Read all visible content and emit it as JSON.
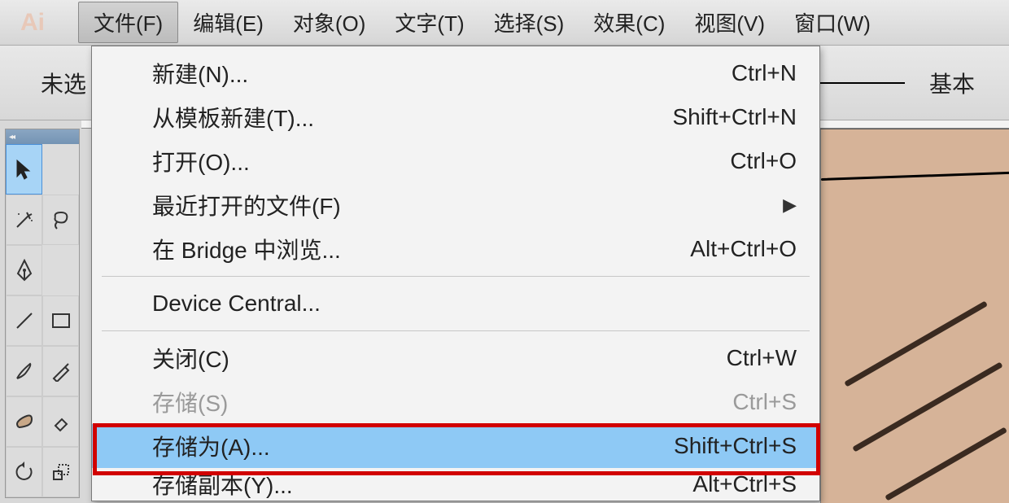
{
  "app": {
    "logo_text": "Ai"
  },
  "menubar": {
    "items": [
      {
        "label": "文件(F)",
        "active": true
      },
      {
        "label": "编辑(E)"
      },
      {
        "label": "对象(O)"
      },
      {
        "label": "文字(T)"
      },
      {
        "label": "选择(S)"
      },
      {
        "label": "效果(C)"
      },
      {
        "label": "视图(V)"
      },
      {
        "label": "窗口(W)"
      }
    ]
  },
  "options_bar": {
    "selection_label": "未选",
    "stroke_style_label": "基本"
  },
  "toolbox": {
    "rows": [
      [
        "selection-tool",
        "direct-selection-tool"
      ],
      [
        "magic-wand-tool",
        "lasso-tool"
      ],
      [
        "pen-tool",
        "type-tool"
      ],
      [
        "line-tool",
        "rectangle-tool"
      ],
      [
        "paintbrush-tool",
        "pencil-tool"
      ],
      [
        "blob-brush-tool",
        "eraser-tool"
      ],
      [
        "rotate-tool",
        "scale-tool"
      ]
    ]
  },
  "dropdown": {
    "items": [
      {
        "label": "新建(N)...",
        "shortcut": "Ctrl+N"
      },
      {
        "label": "从模板新建(T)...",
        "shortcut": "Shift+Ctrl+N"
      },
      {
        "label": "打开(O)...",
        "shortcut": "Ctrl+O"
      },
      {
        "label": "最近打开的文件(F)",
        "submenu": true
      },
      {
        "label": "在 Bridge 中浏览...",
        "shortcut": "Alt+Ctrl+O"
      },
      {
        "separator": true
      },
      {
        "label": "Device Central..."
      },
      {
        "separator": true
      },
      {
        "label": "关闭(C)",
        "shortcut": "Ctrl+W"
      },
      {
        "label": "存储(S)",
        "shortcut": "Ctrl+S",
        "disabled": true
      },
      {
        "label": "存储为(A)...",
        "shortcut": "Shift+Ctrl+S",
        "hovered": true
      },
      {
        "label": "存储副本(Y)...",
        "shortcut": "Alt+Ctrl+S"
      }
    ]
  }
}
